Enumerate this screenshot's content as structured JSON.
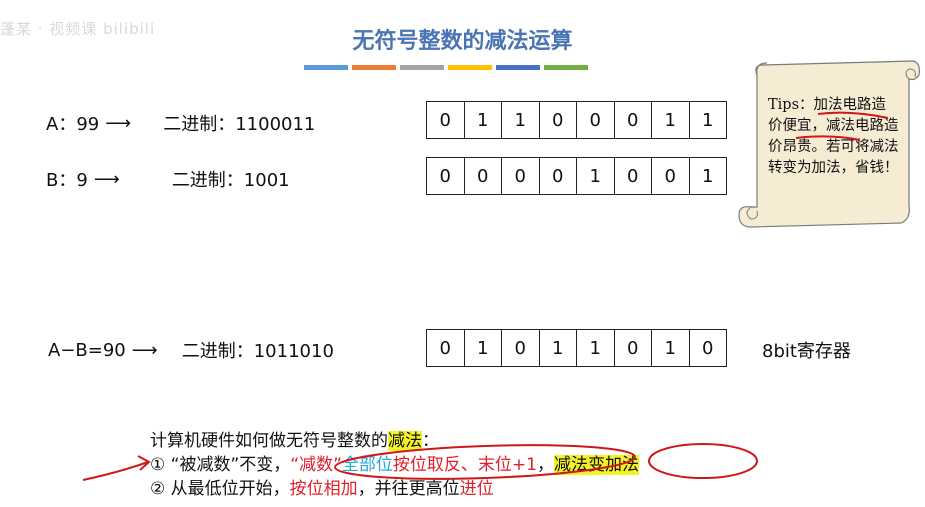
{
  "watermark": "蓬某 · 视频课 bilibili",
  "title": "无符号整数的减法运算",
  "stripe_colors": [
    "#5b9bd5",
    "#ed7d31",
    "#a5a5a5",
    "#ffc000",
    "#4472c4",
    "#70ad47"
  ],
  "rows": [
    {
      "label": "A：99",
      "bin_label": "二进制：1100011",
      "bits": [
        "0",
        "1",
        "1",
        "0",
        "0",
        "0",
        "1",
        "1"
      ]
    },
    {
      "label": "B：9",
      "bin_label": "二进制：1001",
      "bits": [
        "0",
        "0",
        "0",
        "0",
        "1",
        "0",
        "0",
        "1"
      ]
    },
    {
      "label": "A−B=90",
      "bin_label": "二进制：1011010",
      "bits": [
        "0",
        "1",
        "0",
        "1",
        "1",
        "0",
        "1",
        "0"
      ]
    }
  ],
  "register_tag": "8bit寄存器",
  "tips": {
    "prefix": "Tips：",
    "t1": "加法电路",
    "t2": "造价便宜",
    "t3": "，减法电路造价昂贵。若可将减法转变为加法，省钱！"
  },
  "bottom": {
    "heading_a": "计算机硬件如何做无符号整数的",
    "heading_b": "减法",
    "heading_c": "：",
    "l1_a": "① “被减数”不变，",
    "l1_b": "“减数”",
    "l1_c": "全部位",
    "l1_d": "按位取反、末位+1",
    "l1_e": "，",
    "l1_f": "减法变加法",
    "l2_a": "② 从最低位开始，",
    "l2_b": "按位相加",
    "l2_c": "，并往更高位",
    "l2_d": "进位"
  },
  "arrow_glyph": "⟶"
}
